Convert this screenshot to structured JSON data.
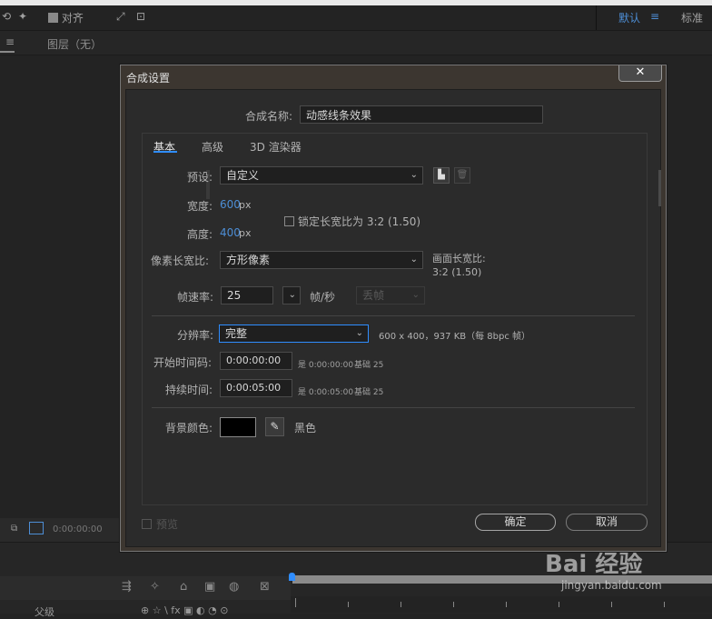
{
  "toolbar": {
    "align_label": "对齐",
    "workspace_default": "默认",
    "workspace_standard": "标准"
  },
  "layer_panel": {
    "title": "图层（无）"
  },
  "dialog": {
    "title": "合成设置",
    "close_label": "✕",
    "name_label": "合成名称:",
    "name_value": "动感线条效果",
    "tabs": [
      "基本",
      "高级",
      "3D 渲染器"
    ],
    "preset_label": "预设:",
    "preset_value": "自定义",
    "width_label": "宽度:",
    "width_value": "600",
    "width_unit": "px",
    "height_label": "高度:",
    "height_value": "400",
    "height_unit": "px",
    "lock_ratio_label": "锁定长宽比为 3:2 (1.50)",
    "pixel_aspect_label": "像素长宽比:",
    "pixel_aspect_value": "方形像素",
    "frame_aspect_label": "画面长宽比:",
    "frame_aspect_value": "3:2 (1.50)",
    "frame_rate_label": "帧速率:",
    "frame_rate_value": "25",
    "frame_rate_unit": "帧/秒",
    "drop_frame_value": "丢帧",
    "resolution_label": "分辨率:",
    "resolution_value": "完整",
    "resolution_info": "600 x 400，937 KB（每 8bpc 帧）",
    "start_tc_label": "开始时间码:",
    "start_tc_value": "0:00:00:00",
    "start_tc_info": "是 0:00:00:00",
    "start_tc_base": "基础 25",
    "duration_label": "持续时间:",
    "duration_value": "0:00:05:00",
    "duration_info": "是 0:00:05:00",
    "duration_base": "基础 25",
    "bg_color_label": "背景颜色:",
    "bg_color_value": "#000000",
    "bg_color_name": "黑色",
    "preview_label": "预览",
    "ok_label": "确定",
    "cancel_label": "取消"
  },
  "bottom": {
    "timecode": "0:00:00:00",
    "parent_label": "父级"
  },
  "watermark": {
    "brand": "Bai 经验",
    "url": "jingyan.baidu.com"
  },
  "colors": {
    "accent": "#2f8dff",
    "link_blue": "#4d8ed6"
  }
}
